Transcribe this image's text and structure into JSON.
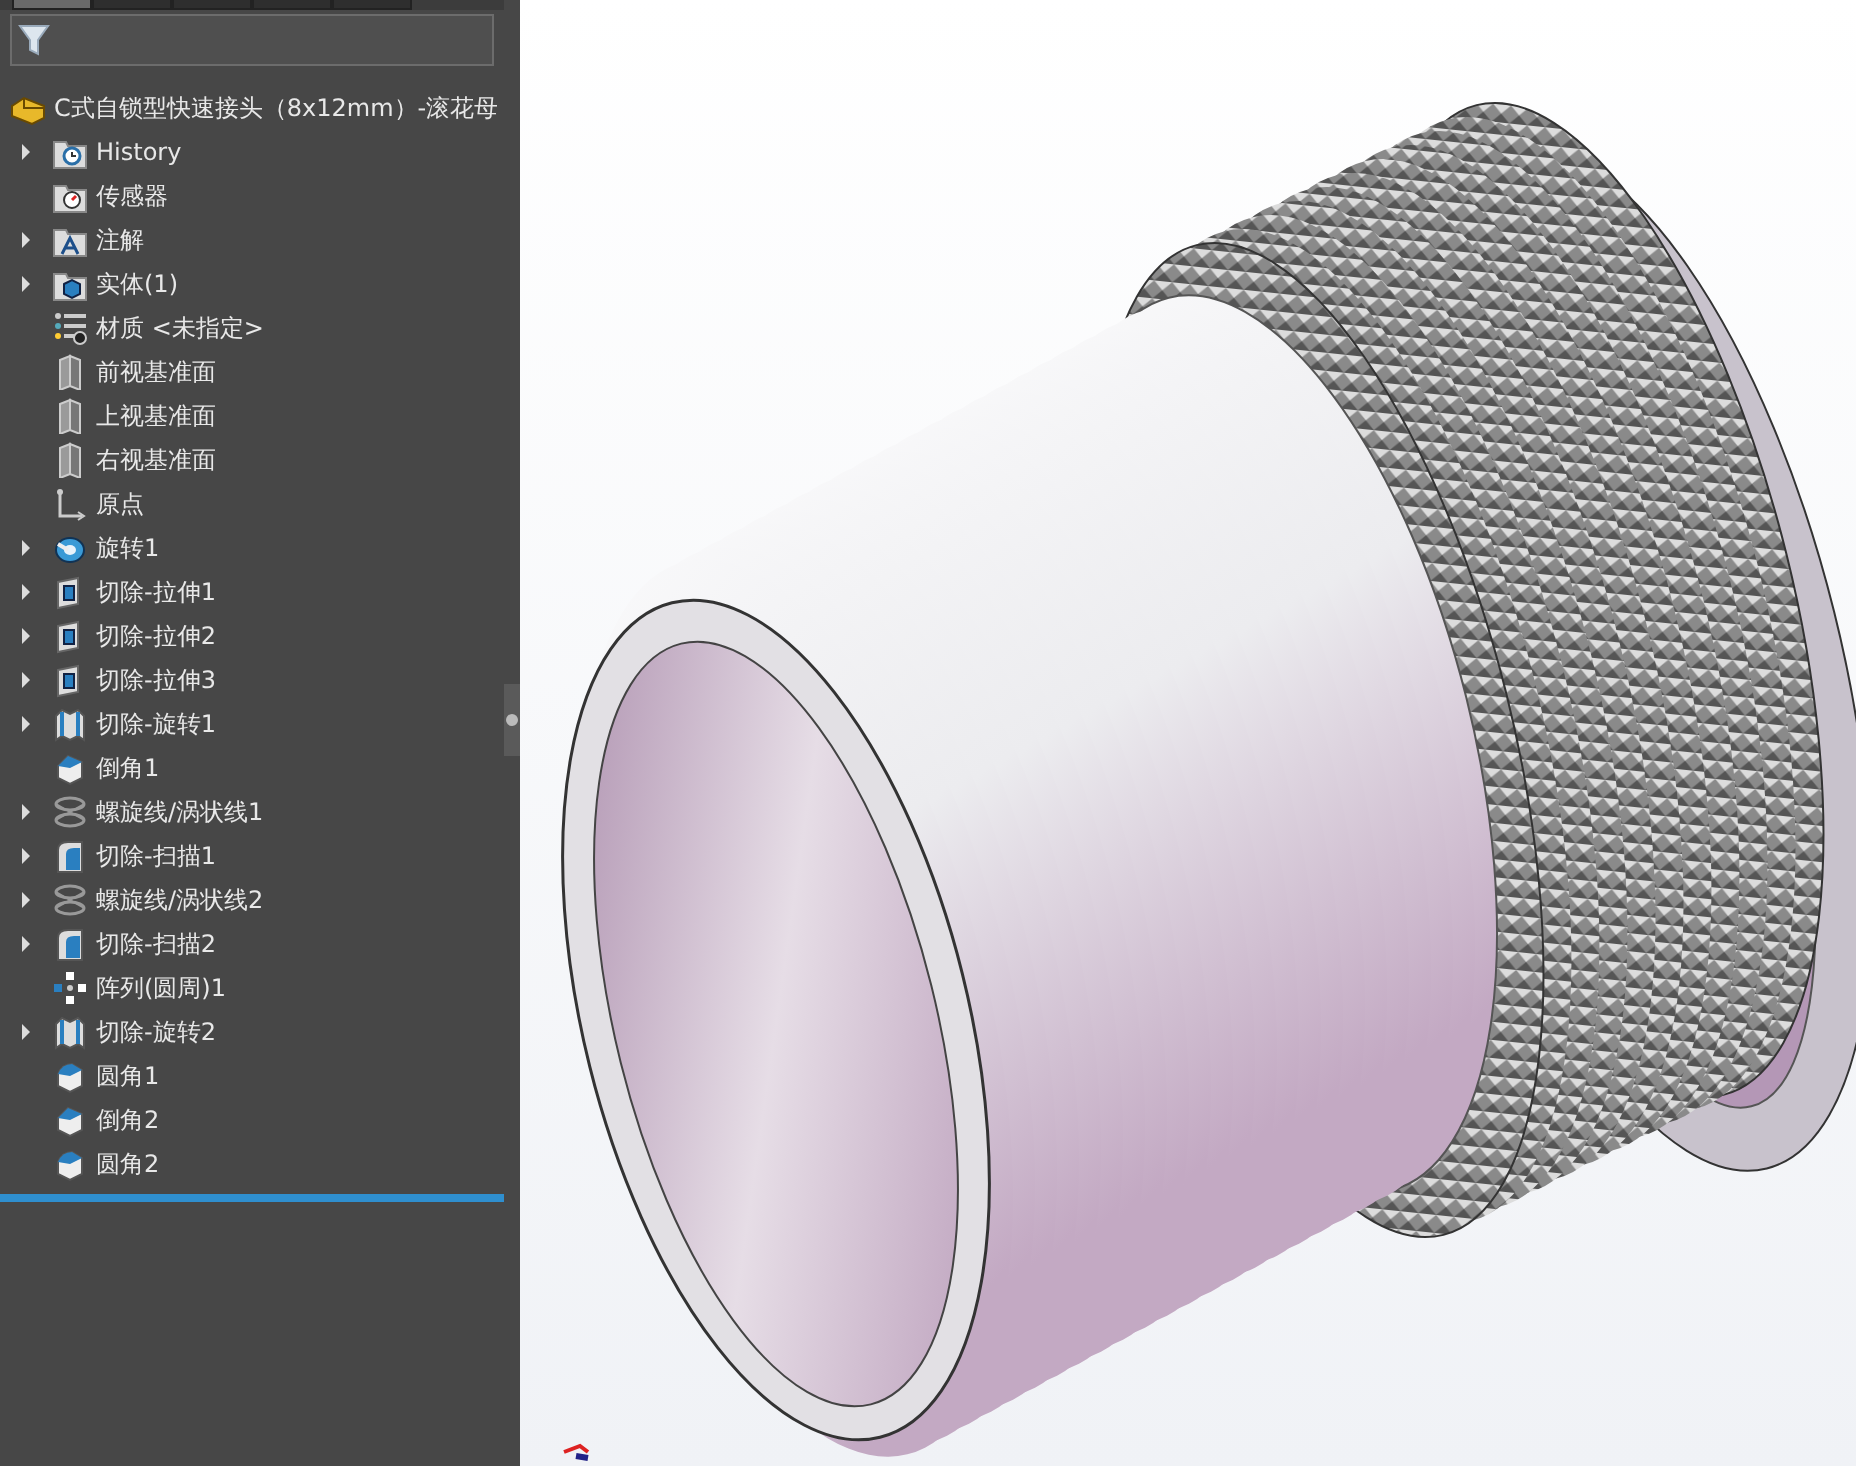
{
  "panel_tabs": [
    {
      "selected": true
    },
    {
      "selected": false
    },
    {
      "selected": false
    },
    {
      "selected": false
    },
    {
      "selected": false
    }
  ],
  "root": {
    "label": "C式自锁型快速接头（8x12mm）-滚花母"
  },
  "tree": [
    {
      "label": "History",
      "kind": "history",
      "expandable": true
    },
    {
      "label": "传感器",
      "kind": "sensor",
      "expandable": false
    },
    {
      "label": "注解",
      "kind": "annotation",
      "expandable": true
    },
    {
      "label": "实体(1)",
      "kind": "solid",
      "expandable": true
    },
    {
      "label": "材质 <未指定>",
      "kind": "material",
      "expandable": false
    },
    {
      "label": "前视基准面",
      "kind": "plane",
      "expandable": false
    },
    {
      "label": "上视基准面",
      "kind": "plane",
      "expandable": false
    },
    {
      "label": "右视基准面",
      "kind": "plane",
      "expandable": false
    },
    {
      "label": "原点",
      "kind": "origin",
      "expandable": false
    },
    {
      "label": "旋转1",
      "kind": "revolve",
      "expandable": true
    },
    {
      "label": "切除-拉伸1",
      "kind": "cut-extrude",
      "expandable": true
    },
    {
      "label": "切除-拉伸2",
      "kind": "cut-extrude",
      "expandable": true
    },
    {
      "label": "切除-拉伸3",
      "kind": "cut-extrude",
      "expandable": true
    },
    {
      "label": "切除-旋转1",
      "kind": "cut-revolve",
      "expandable": true
    },
    {
      "label": "倒角1",
      "kind": "chamfer",
      "expandable": false
    },
    {
      "label": "螺旋线/涡状线1",
      "kind": "helix",
      "expandable": true
    },
    {
      "label": "切除-扫描1",
      "kind": "cut-sweep",
      "expandable": true
    },
    {
      "label": "螺旋线/涡状线2",
      "kind": "helix",
      "expandable": true
    },
    {
      "label": "切除-扫描2",
      "kind": "cut-sweep",
      "expandable": true
    },
    {
      "label": "阵列(圆周)1",
      "kind": "pattern",
      "expandable": false
    },
    {
      "label": "切除-旋转2",
      "kind": "cut-revolve",
      "expandable": true
    },
    {
      "label": "圆角1",
      "kind": "fillet",
      "expandable": false
    },
    {
      "label": "倒角2",
      "kind": "chamfer",
      "expandable": false
    },
    {
      "label": "圆角2",
      "kind": "fillet",
      "expandable": false
    }
  ]
}
